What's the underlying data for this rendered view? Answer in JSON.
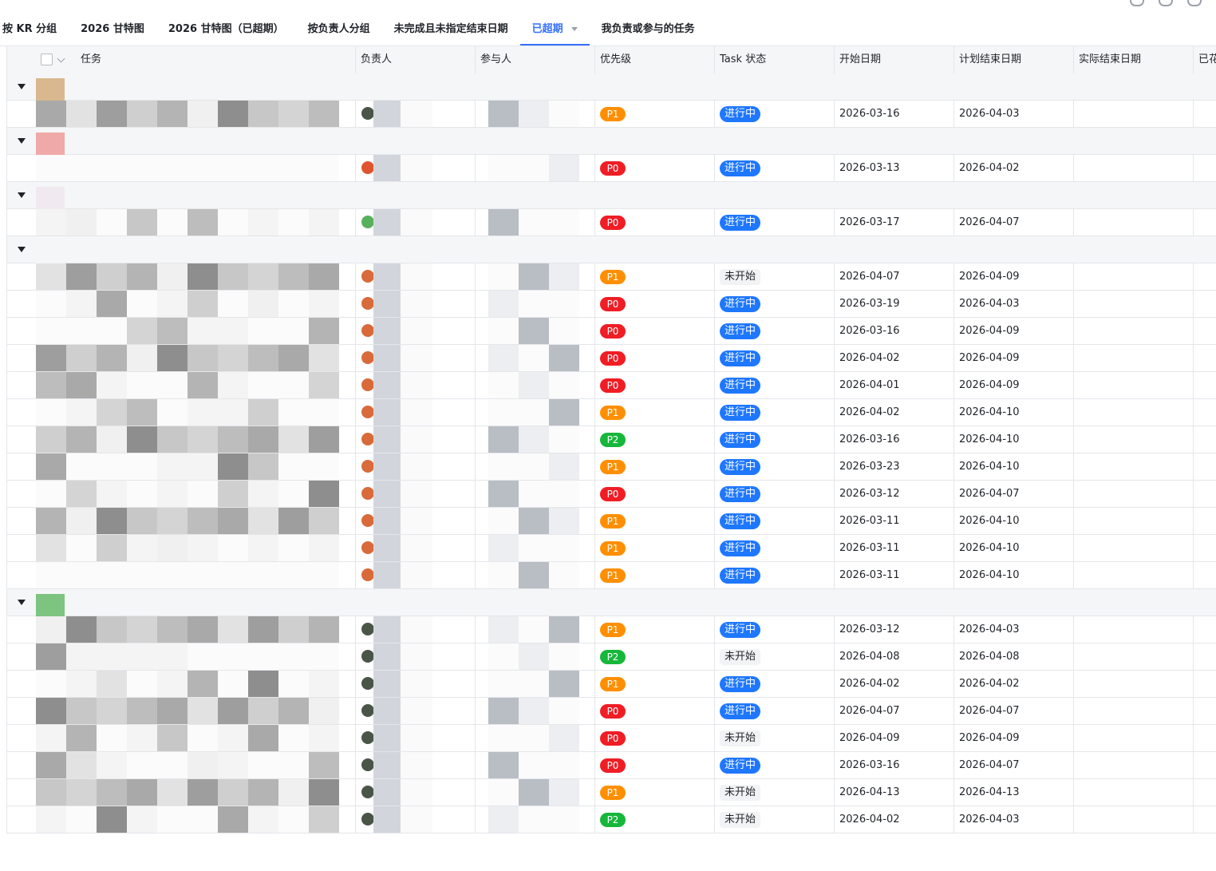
{
  "top_icons": [
    "search-icon",
    "pin-icon",
    "chart-icon"
  ],
  "tabs": [
    {
      "label": "按 KR 分组",
      "active": false
    },
    {
      "label": "2026 甘特图",
      "active": false
    },
    {
      "label": "2026 甘特图（已超期）",
      "active": false
    },
    {
      "label": "按负责人分组",
      "active": false
    },
    {
      "label": "未完成且未指定结束日期",
      "active": false
    },
    {
      "label": "已超期",
      "active": true
    },
    {
      "label": "我负责或参与的任务",
      "active": false
    }
  ],
  "columns": [
    "任务",
    "负责人",
    "参与人",
    "优先级",
    "Task 状态",
    "开始日期",
    "计划结束日期",
    "实际结束日期",
    "已花"
  ],
  "colors": {
    "accent": "#3370ff",
    "status_in_progress": "#1e77ff",
    "P0": "#f01d25",
    "P1": "#ff8f00",
    "P2": "#16b73b"
  },
  "groups": [
    {
      "swatch": "#d9b88f",
      "rows": [
        {
          "priority": "P1",
          "status": "进行中",
          "start": "2026-03-16",
          "end": "2026-04-03"
        }
      ]
    },
    {
      "swatch": "#f0a9a9",
      "rows": [
        {
          "priority": "P0",
          "status": "进行中",
          "start": "2026-03-13",
          "end": "2026-04-02"
        }
      ]
    },
    {
      "swatch": "#f0eaf0",
      "rows": [
        {
          "priority": "P0",
          "status": "进行中",
          "start": "2026-03-17",
          "end": "2026-04-07"
        }
      ]
    },
    {
      "swatch": "#f5f6f7",
      "rows": [
        {
          "priority": "P1",
          "status": "未开始",
          "start": "2026-04-07",
          "end": "2026-04-09"
        },
        {
          "priority": "P0",
          "status": "进行中",
          "start": "2026-03-19",
          "end": "2026-04-03"
        },
        {
          "priority": "P0",
          "status": "进行中",
          "start": "2026-03-16",
          "end": "2026-04-09"
        },
        {
          "priority": "P0",
          "status": "进行中",
          "start": "2026-04-02",
          "end": "2026-04-09"
        },
        {
          "priority": "P0",
          "status": "进行中",
          "start": "2026-04-01",
          "end": "2026-04-09"
        },
        {
          "priority": "P1",
          "status": "进行中",
          "start": "2026-04-02",
          "end": "2026-04-10"
        },
        {
          "priority": "P2",
          "status": "进行中",
          "start": "2026-03-16",
          "end": "2026-04-10"
        },
        {
          "priority": "P1",
          "status": "进行中",
          "start": "2026-03-23",
          "end": "2026-04-10"
        },
        {
          "priority": "P0",
          "status": "进行中",
          "start": "2026-03-12",
          "end": "2026-04-07"
        },
        {
          "priority": "P1",
          "status": "进行中",
          "start": "2026-03-11",
          "end": "2026-04-10"
        },
        {
          "priority": "P1",
          "status": "进行中",
          "start": "2026-03-11",
          "end": "2026-04-10"
        },
        {
          "priority": "P1",
          "status": "进行中",
          "start": "2026-03-11",
          "end": "2026-04-10"
        }
      ]
    },
    {
      "swatch": "#7cc47f",
      "rows": [
        {
          "priority": "P1",
          "status": "进行中",
          "start": "2026-03-12",
          "end": "2026-04-03"
        },
        {
          "priority": "P2",
          "status": "未开始",
          "start": "2026-04-08",
          "end": "2026-04-08"
        },
        {
          "priority": "P1",
          "status": "进行中",
          "start": "2026-04-02",
          "end": "2026-04-02"
        },
        {
          "priority": "P0",
          "status": "进行中",
          "start": "2026-04-07",
          "end": "2026-04-07"
        },
        {
          "priority": "P0",
          "status": "未开始",
          "start": "2026-04-09",
          "end": "2026-04-09"
        },
        {
          "priority": "P0",
          "status": "进行中",
          "start": "2026-03-16",
          "end": "2026-04-07"
        },
        {
          "priority": "P1",
          "status": "未开始",
          "start": "2026-04-13",
          "end": "2026-04-13"
        },
        {
          "priority": "P2",
          "status": "未开始",
          "start": "2026-04-02",
          "end": "2026-04-03"
        }
      ]
    }
  ]
}
